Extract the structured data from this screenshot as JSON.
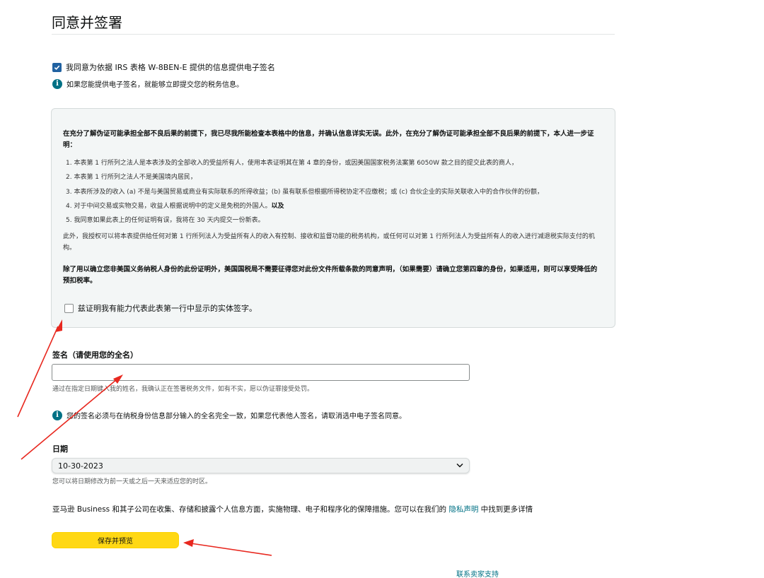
{
  "page": {
    "title": "同意并签署"
  },
  "consent": {
    "checked": true,
    "label": "我同意为依据 IRS 表格 W-8BEN-E 提供的信息提供电子签名"
  },
  "consent_info": {
    "text": "如果您能提供电子签名，就能够立即提交您的税务信息。"
  },
  "certification": {
    "intro": "在充分了解伪证可能承担全部不良后果的前提下，我已尽我所能检查本表格中的信息，并确认信息详实无误。此外，在充分了解伪证可能承担全部不良后果的前提下，本人进一步证明：",
    "items": [
      "1. 本表第 1 行所列之法人是本表涉及的全部收入的受益所有人，使用本表证明其在第 4 章的身份，或因美国国家税务法案第 6050W 款之目的提交此表的商人，",
      "2. 本表第 1 行所列之法人不是美国境内居民，",
      "3. 本表所涉及的收入 (a) 不是与美国贸易或商业有实际联系的所得收益；(b) 虽有联系但根据所得税协定不应缴税；或 (c) 合伙企业的实际关联收入中的合作伙伴的份额，",
      "4. 对于中间交易或实物交易，收益人根据说明中的定义是免税的外国人。",
      "5. 我同意如果此表上的任何证明有误，我将在 30 天内提交一份新表。"
    ],
    "item4_suffix": "以及",
    "authorization": "此外，我授权可以将本表提供给任何对第 1 行所列法人为受益所有人的收入有控制、接收和监督功能的税务机构，或任何可以对第 1 行所列法人为受益所有人的收入进行减退税实际支付的机构。",
    "bold_notice": "除了用以确立您非美国义务纳税人身份的此份证明外，美国国税局不需要征得您对此份文件所载条款的同意声明，（如果需要）请确立您第四章的身份，如果适用，则可以享受降低的预扣税率。",
    "checkbox_checked": false,
    "checkbox_label": "兹证明我有能力代表此表第一行中显示的实体签字。"
  },
  "signature": {
    "label": "签名（请使用您的全名）",
    "value": "",
    "help": "通过在指定日期键入我的姓名，我确认正在签署税务文件，如有不实，愿以伪证罪接受处罚。"
  },
  "signature_info": {
    "text": "您的签名必须与在纳税身份信息部分输入的全名完全一致，如果您代表他人签名，请取消选中电子签名同意。"
  },
  "date": {
    "label": "日期",
    "selected": "10-30-2023",
    "help": "您可以将日期修改为前一天或之后一天来适应您的时区。"
  },
  "privacy": {
    "text_before": "亚马逊 Business 和其子公司在收集、存储和披露个人信息方面，实施物理、电子和程序化的保障措施。您可以在我们的",
    "link": "隐私声明",
    "text_after": "中找到更多详情"
  },
  "actions": {
    "save_label": "保存并预览",
    "support_link": "联系卖家支持"
  },
  "colors": {
    "accent_link": "#007185",
    "button_yellow": "#ffd814",
    "annotation_red": "#e8281f"
  }
}
